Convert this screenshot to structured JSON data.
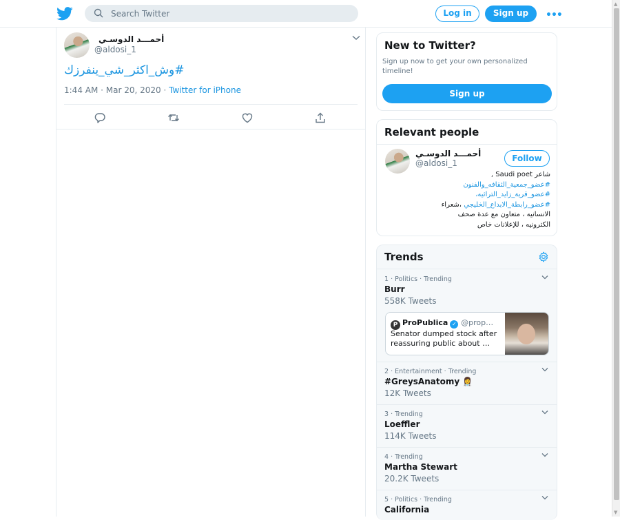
{
  "topbar": {
    "search_placeholder": "Search Twitter",
    "login_label": "Log in",
    "signup_label": "Sign up",
    "more_label": "•••",
    "brand_color": "#1da1f2"
  },
  "tweet": {
    "display_name": "أحمـــد الدوسـي",
    "handle": "@aldosi_1",
    "text": "#وش_اكثر_شي_ينفرزك",
    "time": "1:44 AM · Mar 20, 2020 · ",
    "source": "Twitter for iPhone",
    "actions": [
      "reply-icon",
      "retweet-icon",
      "like-icon",
      "share-icon"
    ]
  },
  "new_to_twitter": {
    "title": "New to Twitter?",
    "description": "Sign up now to get your own personalized timeline!",
    "signup_label": "Sign up"
  },
  "relevant_people": {
    "title": "Relevant people",
    "person": {
      "name": "أحمـــد الدوسـي",
      "handle": "@aldosi_1",
      "follow_label": "Follow",
      "bio_line1": "شاعر Saudi poet ,",
      "bio_line2": "#عضو_جمعية_الثقافه_والفنون",
      "bio_line3": "#عضو_قرية_زايد_التراثيه،",
      "bio_line4a": "#عضو_رابطة_الابداع_الخليجي",
      "bio_line4b": " ،شعراء",
      "bio_line5": "الانسانيه ، متعاون مع عدة صحف",
      "bio_line6": "الكترونيه ، للإعلانات خاص"
    }
  },
  "trends": {
    "title": "Trends",
    "items": [
      {
        "meta": "1 · Politics · Trending",
        "name": "Burr",
        "count": "558K Tweets"
      },
      {
        "meta": "2 · Entertainment · Trending",
        "name": "#GreysAnatomy 👩‍⚕️",
        "count": "12K Tweets"
      },
      {
        "meta": "3 · Trending",
        "name": "Loeffler",
        "count": "114K Tweets"
      },
      {
        "meta": "4 · Trending",
        "name": "Martha Stewart",
        "count": "20.2K Tweets"
      },
      {
        "meta": "5 · Politics · Trending",
        "name": "California",
        "count": ""
      }
    ],
    "news": {
      "source": "ProPublica",
      "handle": "@prop…",
      "text": "Senator dumped stock after reassuring public about …"
    }
  }
}
